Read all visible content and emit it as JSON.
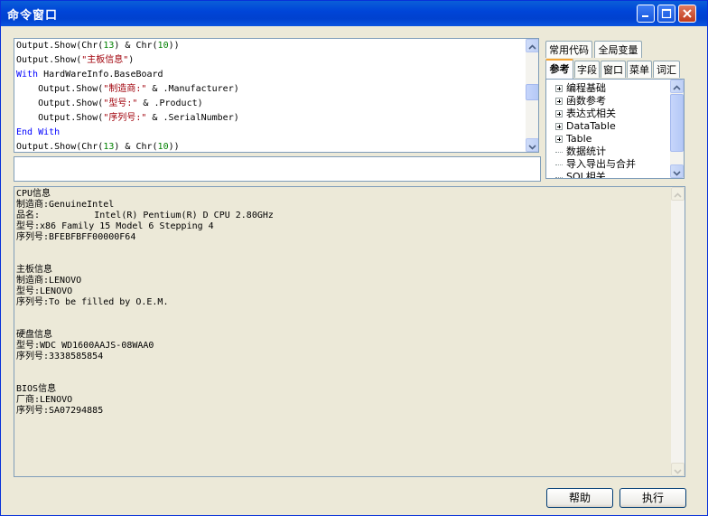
{
  "window": {
    "title": "命令窗口"
  },
  "editor": {
    "lines": [
      "Output.Show(Chr(13) & Chr(10))",
      "Output.Show(\"主板信息\")",
      "With HardWareInfo.BaseBoard",
      "    Output.Show(\"制造商:\" & .Manufacturer)",
      "    Output.Show(\"型号:\" & .Product)",
      "    Output.Show(\"序列号:\" & .SerialNumber)",
      "End With",
      "Output.Show(Chr(13) & Chr(10))"
    ]
  },
  "command_input": {
    "value": ""
  },
  "tabs": {
    "row1": [
      "常用代码",
      "全局变量"
    ],
    "row2": [
      "参考",
      "字段",
      "窗口",
      "菜单",
      "词汇"
    ],
    "active": "参考"
  },
  "tree": {
    "items": [
      {
        "label": "编程基础",
        "expandable": true
      },
      {
        "label": "函数参考",
        "expandable": true
      },
      {
        "label": "表达式相关",
        "expandable": true
      },
      {
        "label": "DataTable",
        "expandable": true
      },
      {
        "label": "Table",
        "expandable": true
      },
      {
        "label": "数据统计",
        "expandable": false
      },
      {
        "label": "导入导出与合并",
        "expandable": false
      },
      {
        "label": "SQL相关",
        "expandable": false
      }
    ]
  },
  "output": {
    "lines": [
      "CPU信息",
      "制造商:GenuineIntel",
      "品名:          Intel(R) Pentium(R) D CPU 2.80GHz",
      "型号:x86 Family 15 Model 6 Stepping 4",
      "序列号:BFEBFBFF00000F64",
      "",
      "",
      "主板信息",
      "制造商:LENOVO",
      "型号:LENOVO",
      "序列号:To be filled by O.E.M.",
      "",
      "",
      "硬盘信息",
      "型号:WDC WD1600AAJS-08WAA0",
      "序列号:3338585854",
      "",
      "",
      "BIOS信息",
      "厂商:LENOVO",
      "序列号:SA07294885"
    ]
  },
  "buttons": {
    "help": "帮助",
    "execute": "执行"
  },
  "colors": {
    "titlebar": "#0045d8",
    "keyword": "#0000ff",
    "string": "#a0000a",
    "number": "#008000"
  }
}
